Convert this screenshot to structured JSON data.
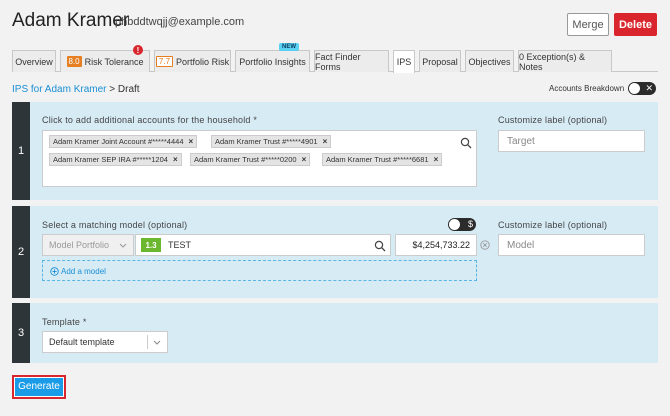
{
  "header": {
    "client_name": "Adam Kramer",
    "email": "phbddtwqjj@example.com",
    "merge_label": "Merge",
    "delete_label": "Delete"
  },
  "tabs": [
    {
      "label": "Overview"
    },
    {
      "label": "Risk Tolerance",
      "score": "8.0",
      "alert": "!"
    },
    {
      "label": "Portfolio Risk",
      "score": "7.7"
    },
    {
      "label": "Portfolio Insights",
      "badge": "NEW"
    },
    {
      "label": "Fact Finder Forms"
    },
    {
      "label": "IPS",
      "active": true
    },
    {
      "label": "Proposal"
    },
    {
      "label": "Objectives"
    },
    {
      "label": "0 Exception(s) & Notes"
    }
  ],
  "breadcrumb": {
    "link": "IPS for Adam Kramer",
    "separator": ">",
    "current": "Draft"
  },
  "accounts_breakdown": {
    "label": "Accounts Breakdown",
    "toggle_glyph": "✕"
  },
  "section1": {
    "number": "1",
    "label": "Click to add additional accounts for the household *",
    "accounts": [
      "Adam Kramer Joint Account #*****4444",
      "Adam Kramer Trust #*****4901",
      "Adam Kramer SEP IRA #*****1204",
      "Adam Kramer Trust #*****0200",
      "Adam Kramer Trust #*****6681"
    ],
    "remove_glyph": "×",
    "customize_label": "Customize label (optional)",
    "customize_placeholder": "Target"
  },
  "section2": {
    "number": "2",
    "label": "Select a matching model (optional)",
    "toggle_glyph": "$",
    "model_type": "Model Portfolio",
    "model_score": "1.3",
    "model_name": "TEST",
    "amount": "$4,254,733.22",
    "add_model_label": "Add a model",
    "customize_label": "Customize label (optional)",
    "customize_placeholder": "Model"
  },
  "section3": {
    "number": "3",
    "label": "Template *",
    "template_value": "Default template"
  },
  "generate_label": "Generate",
  "colors": {
    "accent_blue": "#1a9be8",
    "danger_red": "#d9262e",
    "section_bg": "#d7ebf5",
    "section_num_bg": "#2e3539",
    "score_orange": "#e67e22",
    "model_green": "#6bb82f"
  }
}
